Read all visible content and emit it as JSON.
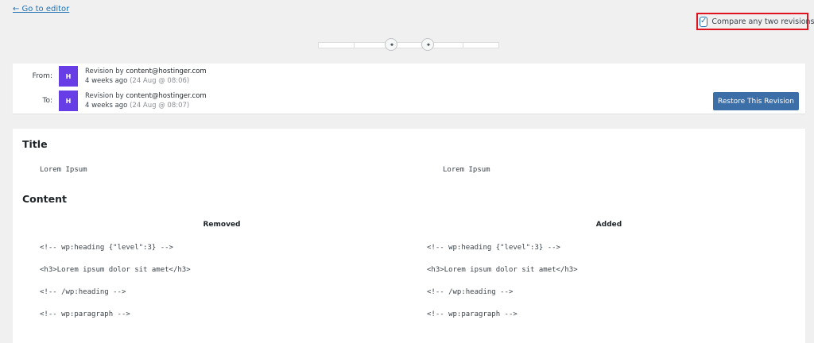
{
  "nav": {
    "back_label": "← Go to editor"
  },
  "compare": {
    "label": "Compare any two revisions",
    "checked": true,
    "check_glyph": "✓"
  },
  "slider": {
    "segments": 5,
    "from_index": 2,
    "to_index": 3,
    "handle_glyph": "◂▸"
  },
  "meta": {
    "from": {
      "label": "From:",
      "avatar": "H",
      "author_prefix": "Revision by ",
      "author": "content@hostinger.com",
      "ago": "4 weeks ago ",
      "date": "(24 Aug @ 08:06)"
    },
    "to": {
      "label": "To:",
      "avatar": "H",
      "author_prefix": "Revision by ",
      "author": "content@hostinger.com",
      "ago": "4 weeks ago ",
      "date": "(24 Aug @ 08:07)"
    },
    "restore_label": "Restore This Revision"
  },
  "diff": {
    "title_heading": "Title",
    "title_left": "Lorem Ipsum",
    "title_right": "Lorem Ipsum",
    "content_heading": "Content",
    "removed_label": "Removed",
    "added_label": "Added",
    "rows": [
      {
        "left": "<!-- wp:heading {\"level\":3} -->",
        "right": "<!-- wp:heading {\"level\":3} -->"
      },
      {
        "left": "<h3>Lorem ipsum dolor sit amet</h3>",
        "right": "<h3>Lorem ipsum dolor sit amet</h3>"
      },
      {
        "left": "<!-- /wp:heading -->",
        "right": "<!-- /wp:heading -->"
      },
      {
        "left": "<!-- wp:paragraph -->",
        "right": "<!-- wp:paragraph -->"
      }
    ]
  }
}
